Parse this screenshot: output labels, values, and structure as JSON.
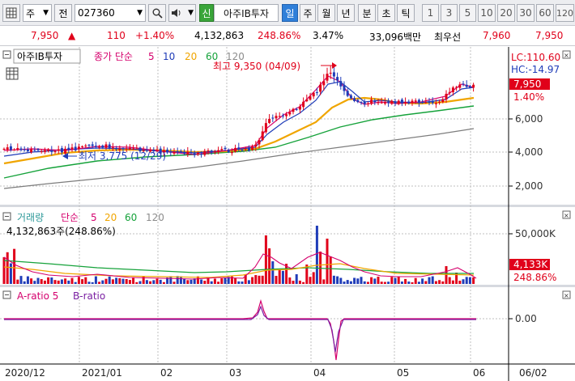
{
  "toolbar": {
    "menu_icon": "grid-icon",
    "market_select": "주",
    "prefix_label": "전",
    "code_value": "027360",
    "credit_badge": "신",
    "stock_name": "아주IB투자",
    "periods": [
      "일",
      "주",
      "월",
      "년",
      "분",
      "초",
      "틱"
    ],
    "selected_period": "일",
    "numbers": [
      "1",
      "3",
      "5",
      "10",
      "20",
      "30",
      "60",
      "120"
    ]
  },
  "quote": {
    "price": "7,950",
    "change": "110",
    "change_pct": "+1.40%",
    "volume": "4,132,863",
    "volume_ratio": "248.86%",
    "turnover": "3.47%",
    "amount": "33,096백만",
    "best_label": "최우선",
    "ask": "7,960",
    "bid": "7,950",
    "up_color": "#e0001a"
  },
  "price_panel": {
    "name_tag": "아주IB투자",
    "legend_title": "종가 단순",
    "ma_periods": [
      "5",
      "10",
      "20",
      "60",
      "120"
    ],
    "ma_colors": [
      "#d5006d",
      "#1f3cb8",
      "#f0a500",
      "#15a23a",
      "#8c8c8c"
    ],
    "lc": "LC:110.60",
    "hc": "HC:-14.97",
    "high_note": "최고 9,350 (04/09)",
    "low_note": "최저 3,775 (12/29)",
    "current_tag": "7,950",
    "pct_tag": "1.40%"
  },
  "volume_panel": {
    "title": "거래량",
    "legend_title": "단순",
    "ma_periods": [
      "5",
      "20",
      "60",
      "120"
    ],
    "info": "4,132,863주(248.86%)",
    "current_tag": "4,133K",
    "pct_tag": "248.86%"
  },
  "ratio_panel": {
    "a_label": "A-ratio 5",
    "b_label": "B-ratio"
  },
  "axis": {
    "price_ticks": [
      "6,000",
      "4,000",
      "2,000"
    ],
    "volume_ticks": [
      "50,000K"
    ],
    "ratio_ticks": [
      "0.00"
    ],
    "dates": [
      "2020/12",
      "2021/01",
      "02",
      "03",
      "04",
      "05",
      "06"
    ],
    "right_date": "06/02"
  }
}
